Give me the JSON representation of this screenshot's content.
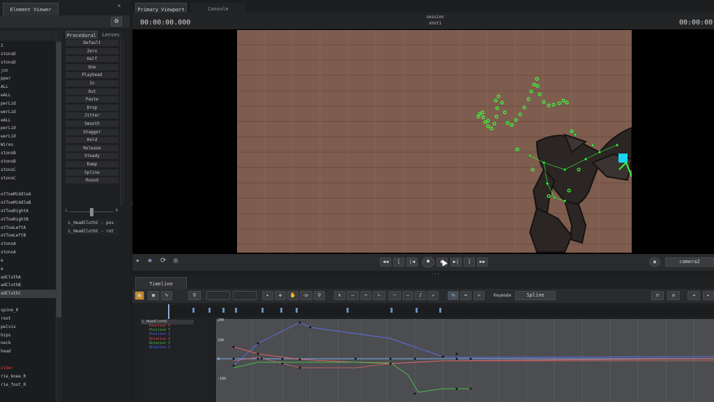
{
  "left_panel": {
    "title": "Element Viewer",
    "elements": [
      "2",
      "stonsD",
      "stonsD",
      "jnt",
      "pper",
      "ALL",
      "eALL",
      "perLid",
      "werLid",
      "eALL",
      "perLid",
      "werLid",
      "Wires",
      "stonsB",
      "stonsB",
      "stonsC",
      "stonsC",
      "",
      "otToeMiddleA",
      "otToeMiddleB",
      "otToeRightA",
      "otToeRightB",
      "otToeLeftA",
      "otToeLeftB",
      "stonsA",
      "stonsA",
      "e",
      "e",
      "adClothA",
      "adClothB",
      "adClothC",
      "",
      "spine_0",
      "root",
      "pelvis",
      "hips",
      "neck",
      "head",
      "",
      "ulder",
      "rie_knee_R",
      "rie_foot_R"
    ],
    "selected_index": 30,
    "red_index": 39,
    "proc_tabs": [
      "Procedural",
      "Lenses"
    ],
    "proc_items": [
      "Default",
      "Zero",
      "Half",
      "One",
      "Playhead",
      "In",
      "Out",
      "Paste",
      "Drop",
      "Jitter",
      "Smooth",
      "Stagger",
      "Hold",
      "Release",
      "Steady",
      "Ramp",
      "Spline",
      "Round"
    ],
    "slider_left": "L",
    "slider_right": "R",
    "takes": [
      "L_HeadClothC - pos",
      "L_HeadClothC - rot"
    ]
  },
  "viewport": {
    "tabs": [
      "Primary Viewport",
      "Console"
    ],
    "timecode_left": "00:00:00.000",
    "timecode_right": "00:00:00.",
    "session_label": "session",
    "shot_label": "shot1",
    "camera": "camera2"
  },
  "timeline": {
    "tab": "Timeline",
    "keymode_label": "Keymode",
    "keymode_value": "Spline",
    "channel_parent": "L_HeadClothC",
    "channels": [
      {
        "name": "Position X",
        "color": "#e04a4a"
      },
      {
        "name": "Position Y",
        "color": "#4ac04a"
      },
      {
        "name": "Position Z",
        "color": "#4a6ae0"
      },
      {
        "name": "Rotation X",
        "color": "#e04a4a"
      },
      {
        "name": "Rotation Y",
        "color": "#4ac04a"
      },
      {
        "name": "Rotation Z",
        "color": "#4a6ae0"
      }
    ],
    "y_labels": [
      "200",
      "100",
      "0",
      "-100"
    ]
  },
  "colors": {
    "accent": "#6a8fc0",
    "scene_bg": "#7e5d4e",
    "marker": "#3cff3c",
    "cube": "#18d6f0"
  }
}
